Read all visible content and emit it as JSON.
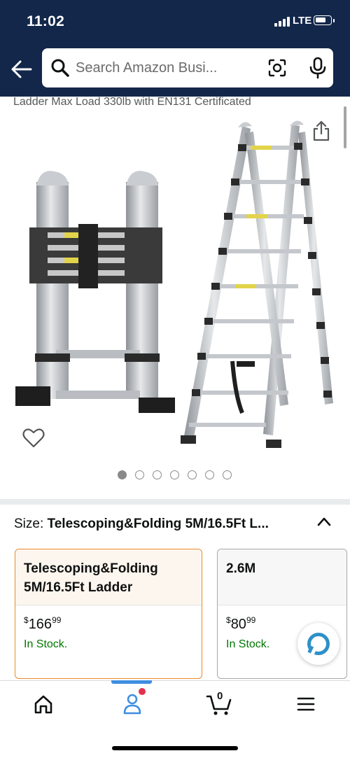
{
  "status_bar": {
    "time": "11:02",
    "network": "LTE"
  },
  "header": {
    "search_placeholder": "Search Amazon Busi...",
    "icons": [
      "back-arrow-icon",
      "search-icon",
      "camera-scan-icon",
      "microphone-icon"
    ]
  },
  "product": {
    "title_fragment": "Ladder Max Load 330lb with EN131 Certificated",
    "image_count": 7,
    "active_image": 1
  },
  "size": {
    "label": "Size:",
    "selected": "Telescoping&Folding 5M/16.5Ft L..."
  },
  "options": [
    {
      "name": "Telescoping&Folding 5M/16.5Ft Ladder",
      "price_whole": "166",
      "price_fraction": "99",
      "currency": "$",
      "stock": "In Stock.",
      "selected": true
    },
    {
      "name": "2.6M",
      "price_whole": "80",
      "price_fraction": "99",
      "currency": "$",
      "stock": "In Stock.",
      "selected": false
    }
  ],
  "bottom_nav": {
    "items": [
      "home-icon",
      "account-icon",
      "cart-icon",
      "menu-icon"
    ],
    "cart_count": "0"
  },
  "colors": {
    "header": "#13274a",
    "stock": "#007600",
    "selected_border": "#e88a2c",
    "nav_active": "#3f8ee0"
  }
}
